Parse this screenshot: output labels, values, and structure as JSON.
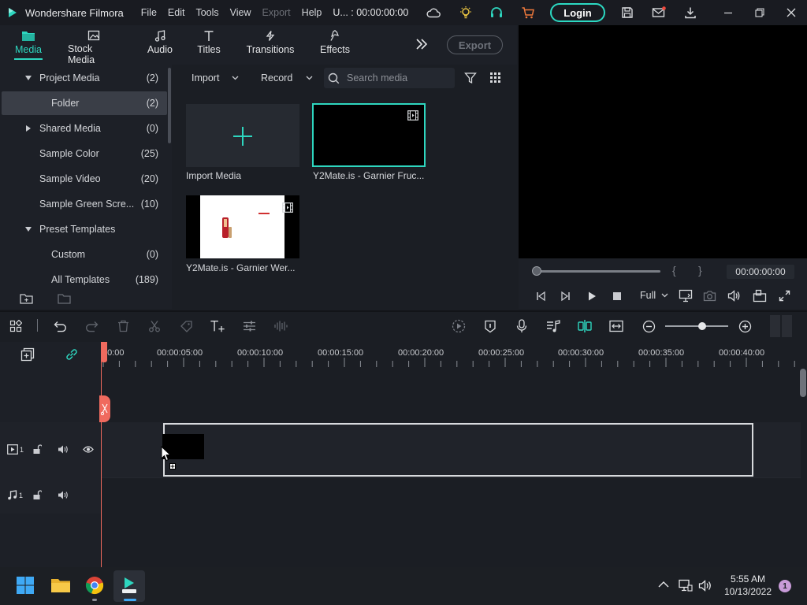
{
  "app": {
    "name": "Wondershare Filmora",
    "menus": [
      "File",
      "Edit",
      "Tools",
      "View",
      "Export",
      "Help"
    ],
    "project_title": "U... : 00:00:00:00",
    "login_label": "Login"
  },
  "tabs": [
    {
      "label": "Media",
      "icon": "media-folder-icon",
      "active": true
    },
    {
      "label": "Stock Media",
      "icon": "stock-media-icon",
      "active": false
    },
    {
      "label": "Audio",
      "icon": "music-note-icon",
      "active": false
    },
    {
      "label": "Titles",
      "icon": "text-t-icon",
      "active": false
    },
    {
      "label": "Transitions",
      "icon": "transition-icon",
      "active": false
    },
    {
      "label": "Effects",
      "icon": "effects-icon",
      "active": false
    }
  ],
  "export_label": "Export",
  "sidebar": {
    "items": [
      {
        "name": "Project Media",
        "count": "(2)"
      },
      {
        "name": "Folder",
        "count": "(2)"
      },
      {
        "name": "Shared Media",
        "count": "(0)"
      },
      {
        "name": "Sample Color",
        "count": "(25)"
      },
      {
        "name": "Sample Video",
        "count": "(20)"
      },
      {
        "name": "Sample Green Scre...",
        "count": "(10)"
      },
      {
        "name": "Preset Templates",
        "count": ""
      },
      {
        "name": "Custom",
        "count": "(0)"
      },
      {
        "name": "All Templates",
        "count": "(189)"
      }
    ]
  },
  "media_toolbar": {
    "import_label": "Import",
    "record_label": "Record",
    "search_placeholder": "Search media"
  },
  "media_items": [
    {
      "label": "Import Media"
    },
    {
      "label": "Y2Mate.is - Garnier Fruc..."
    },
    {
      "label": "Y2Mate.is - Garnier Wer..."
    }
  ],
  "preview": {
    "timecode": "00:00:00:00",
    "quality": "Full",
    "brace_left": "{",
    "brace_right": "}"
  },
  "ruler": {
    "labels": [
      "00:00",
      "00:00:05:00",
      "00:00:10:00",
      "00:00:15:00",
      "00:00:20:00",
      "00:00:25:00",
      "00:00:30:00",
      "00:00:35:00",
      "00:00:40:00"
    ]
  },
  "tracks": {
    "video_index": "1",
    "audio_index": "1"
  },
  "taskbar": {
    "time": "5:55 AM",
    "date": "10/13/2022",
    "notifications": "1"
  },
  "colors": {
    "accent": "#2ed6bf",
    "playhead": "#f06a5e"
  }
}
